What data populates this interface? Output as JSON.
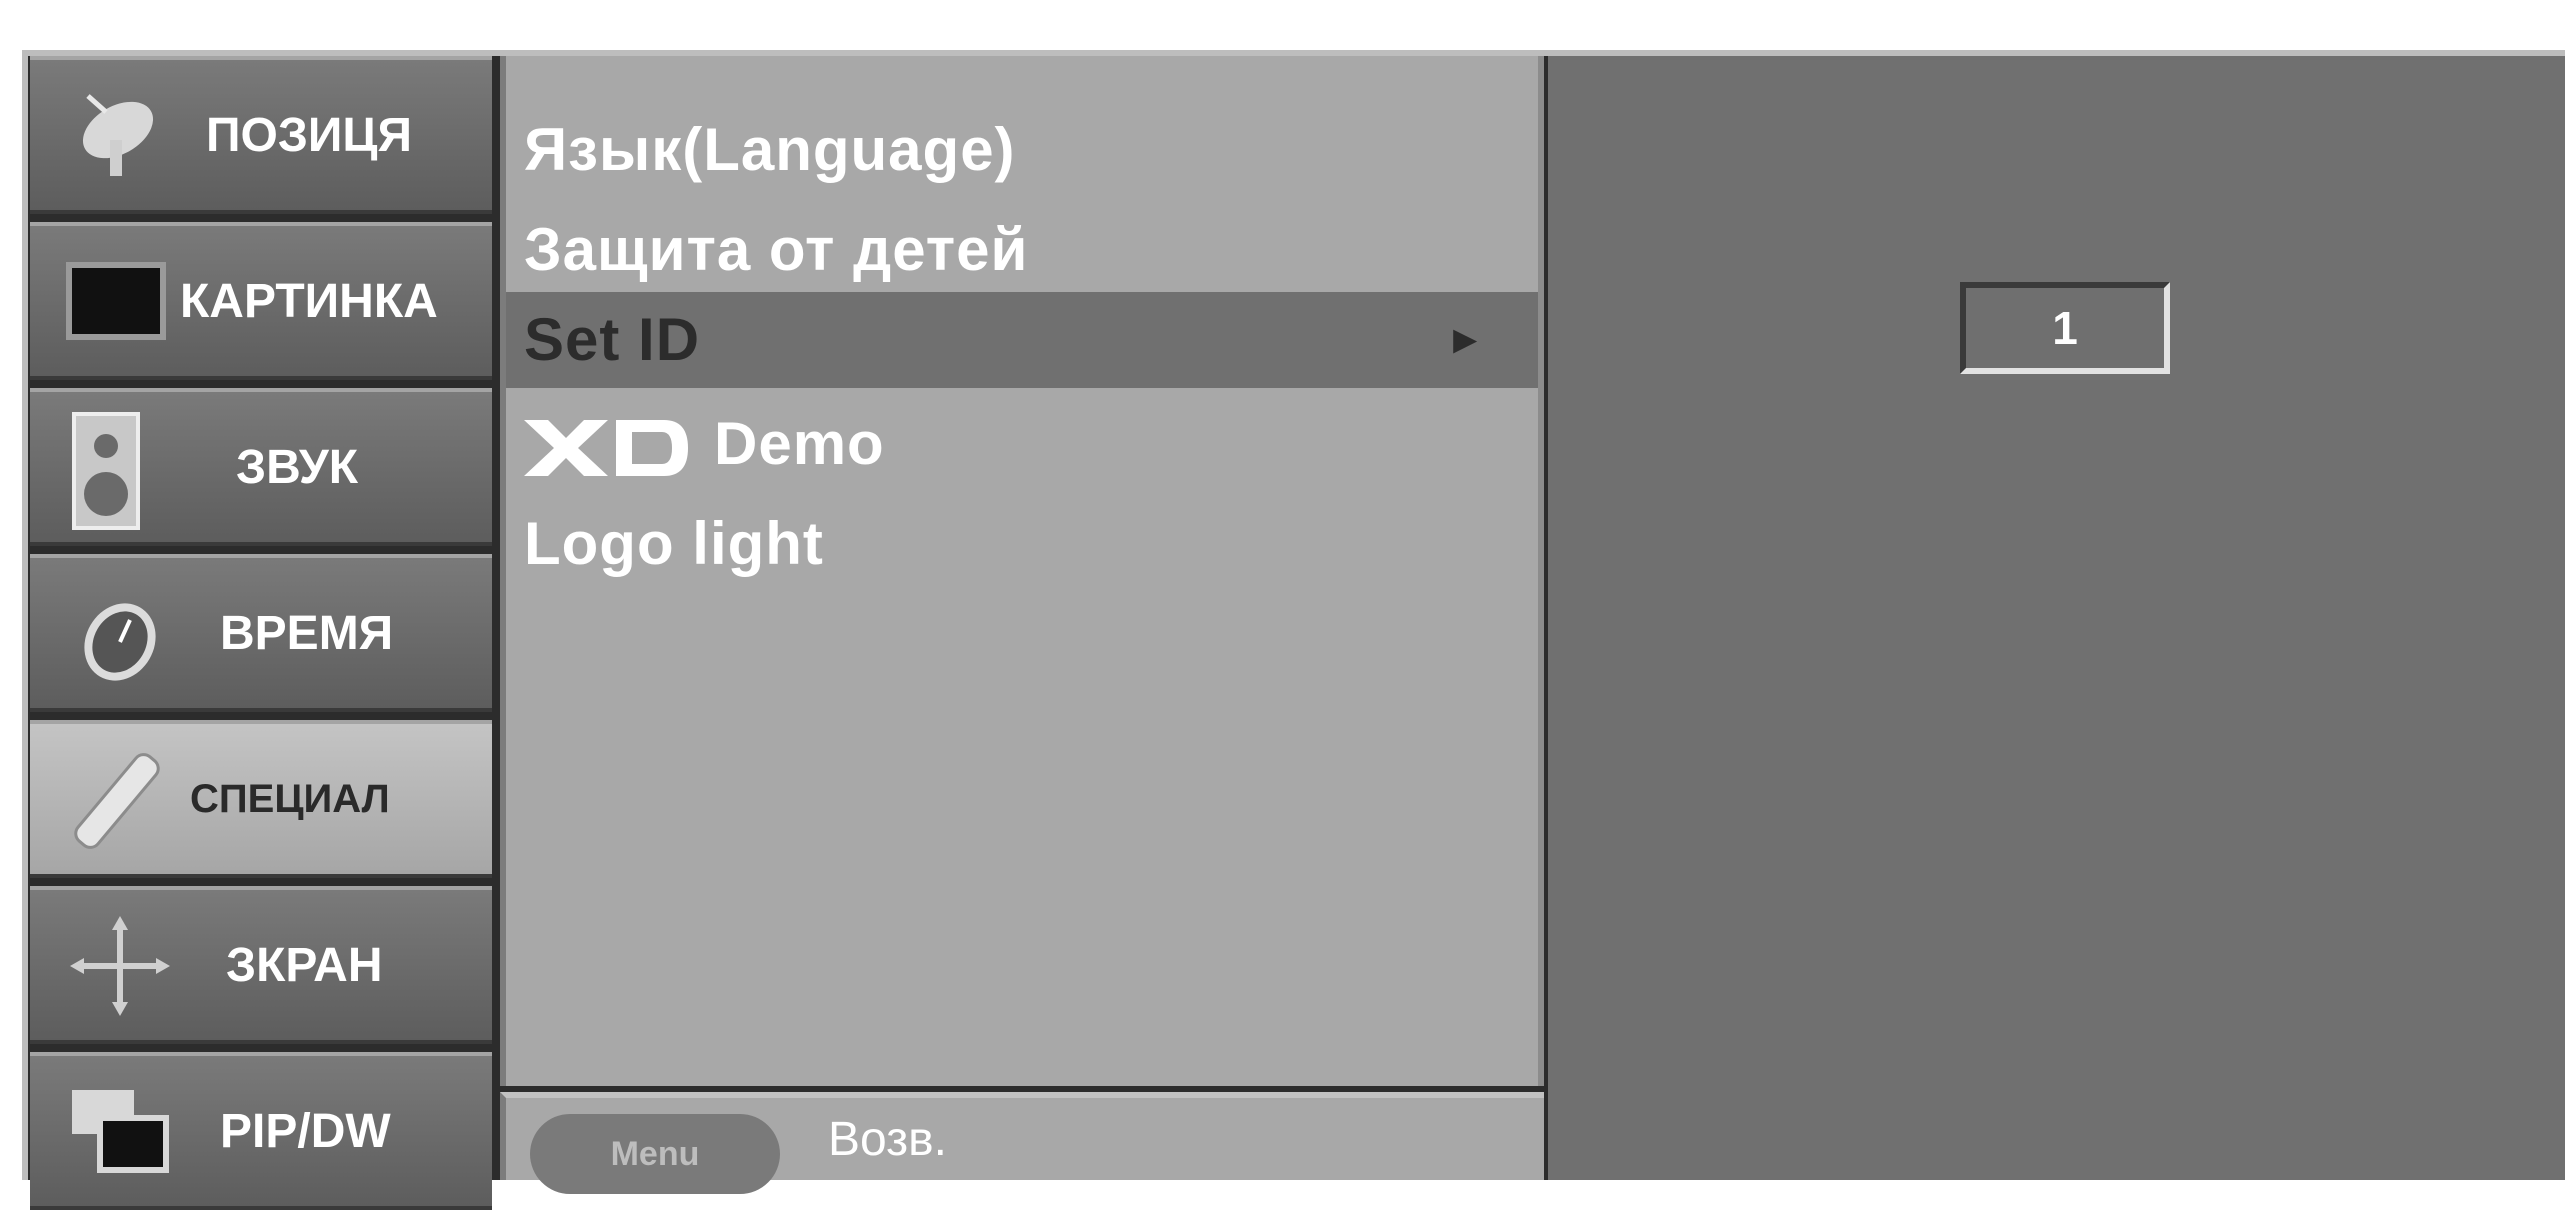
{
  "sidebar": {
    "items": [
      {
        "label": "ПОЗИЦЯ",
        "icon": "satellite-dish-icon"
      },
      {
        "label": "КАРТИНКА",
        "icon": "picture-monitor-icon"
      },
      {
        "label": "ЗВУК",
        "icon": "speaker-icon"
      },
      {
        "label": "ВРЕМЯ",
        "icon": "clock-icon"
      },
      {
        "label": "СПЕЦИАЛ",
        "icon": "remote-control-icon"
      },
      {
        "label": "ЗКРАН",
        "icon": "screen-arrows-icon"
      },
      {
        "label": "PIP/DW",
        "icon": "pip-icon"
      }
    ],
    "active_index": 4
  },
  "menu": {
    "items": [
      {
        "label": "Язык(Language)"
      },
      {
        "label": "Защита от детей"
      },
      {
        "label": "Set ID",
        "arrow": "►"
      },
      {
        "label": "Demo",
        "logo": "XD"
      },
      {
        "label": "Logo light"
      }
    ],
    "selected_index": 2
  },
  "bottom": {
    "menu_button": "Menu",
    "return_label": "Возв."
  },
  "panel": {
    "set_id_value": "1"
  },
  "colors": {
    "sidebar_bg": "#6b6b6b",
    "sidebar_active": "#b5b5b5",
    "menu_bg": "#a8a8a8",
    "selected_row": "#707070",
    "panel_bg": "#707070"
  }
}
